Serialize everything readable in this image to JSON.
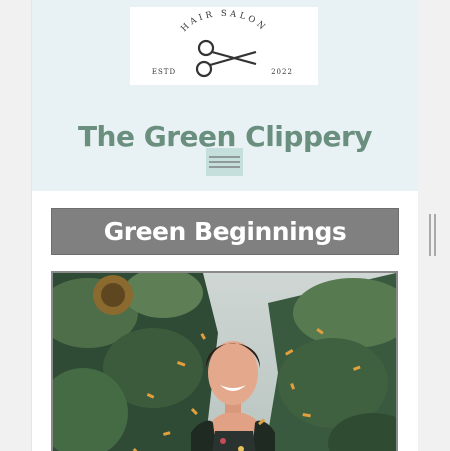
{
  "logo": {
    "arc_text": "HAIR SALON",
    "left_text": "ESTD",
    "right_text": "2022",
    "icon": "scissors-icon"
  },
  "site": {
    "title": "The Green Clippery"
  },
  "nav": {
    "menu_icon": "hamburger-menu-icon"
  },
  "section": {
    "title": "Green Beginnings"
  },
  "hero": {
    "description": ""
  },
  "colors": {
    "header_bg": "#e8f1f3",
    "title_green": "#6a8f7f",
    "menu_bg": "#c5e0dc",
    "banner_gray": "#808080"
  }
}
